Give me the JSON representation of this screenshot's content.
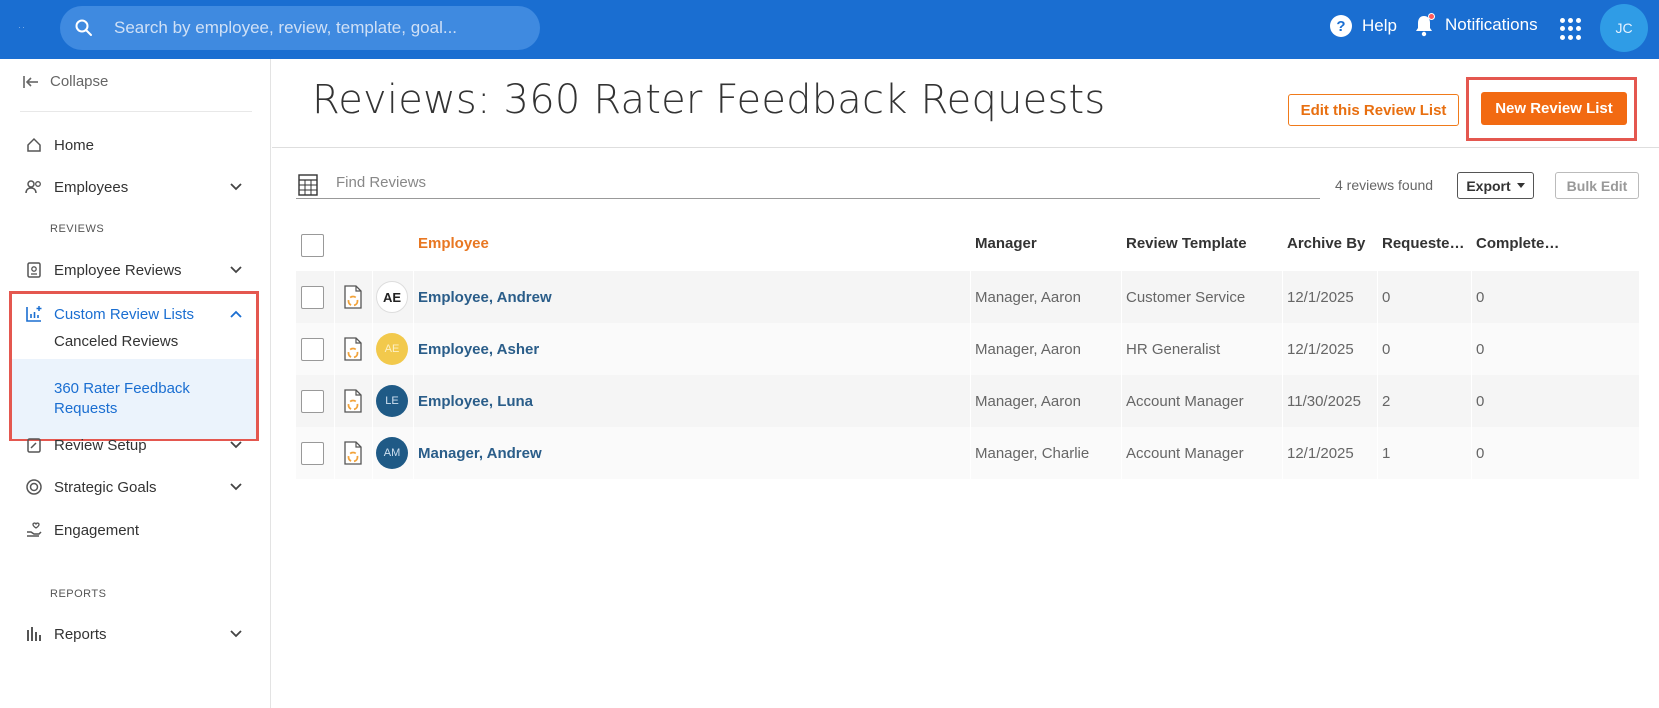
{
  "topbar": {
    "search_placeholder": "Search by employee, review, template, goal...",
    "help_label": "Help",
    "notifications_label": "Notifications",
    "user_initials": "JC"
  },
  "sidebar": {
    "collapse_label": "Collapse",
    "home": "Home",
    "employees": "Employees",
    "section_reviews": "REVIEWS",
    "employee_reviews": "Employee Reviews",
    "custom_review_lists": "Custom Review Lists",
    "sub_items": [
      "Canceled Reviews",
      "360 Rater Feedback Requests"
    ],
    "review_setup": "Review Setup",
    "strategic_goals": "Strategic Goals",
    "engagement": "Engagement",
    "section_reports": "REPORTS",
    "reports": "Reports"
  },
  "main": {
    "title": "Reviews: 360 Rater Feedback Requests",
    "edit_button": "Edit this Review List",
    "new_button": "New Review List",
    "find_placeholder": "Find Reviews",
    "found_text": "4 reviews found",
    "export_button": "Export",
    "bulk_edit_button": "Bulk Edit"
  },
  "table": {
    "columns": [
      "Employee",
      "Manager",
      "Review Template",
      "Archive By",
      "Requeste…",
      "Complete…"
    ],
    "rows": [
      {
        "initials": "AE",
        "avatar_bg": "#ffffff",
        "avatar_fg": "#222222",
        "employee": "Employee, Andrew",
        "manager": "Manager, Aaron",
        "template": "Customer Service",
        "archive_by": "12/1/2025",
        "requested": "0",
        "completed": "0"
      },
      {
        "initials": "AE",
        "avatar_bg": "#f2c94c",
        "avatar_fg": "#fdf0c4",
        "employee": "Employee, Asher",
        "manager": "Manager, Aaron",
        "template": "HR Generalist",
        "archive_by": "12/1/2025",
        "requested": "0",
        "completed": "0"
      },
      {
        "initials": "LE",
        "avatar_bg": "#1f5a86",
        "avatar_fg": "#cfe0f0",
        "employee": "Employee, Luna",
        "manager": "Manager, Aaron",
        "template": "Account Manager",
        "archive_by": "11/30/2025",
        "requested": "2",
        "completed": "0"
      },
      {
        "initials": "AM",
        "avatar_bg": "#1f5a86",
        "avatar_fg": "#cfe0f0",
        "employee": "Manager, Andrew",
        "manager": "Manager, Charlie",
        "template": "Account Manager",
        "archive_by": "12/1/2025",
        "requested": "1",
        "completed": "0"
      }
    ]
  },
  "colors": {
    "topbar": "#1a6ed1",
    "accent_orange": "#f26a12",
    "highlight_red": "#e4574f",
    "link_blue": "#2a5d89"
  }
}
